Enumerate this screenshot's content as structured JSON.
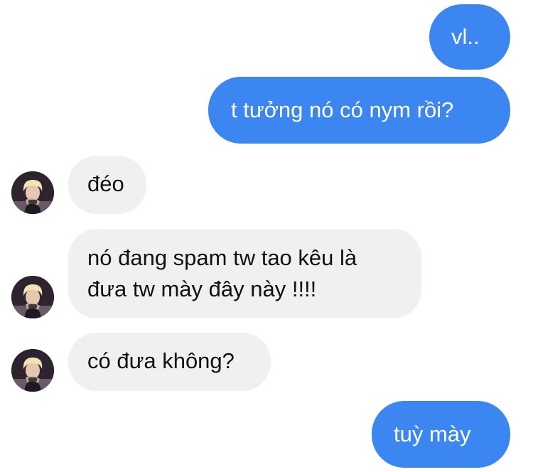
{
  "messages": [
    {
      "direction": "outgoing",
      "text": "vl.."
    },
    {
      "direction": "outgoing",
      "text": "t tưởng nó có nym rồi?"
    },
    {
      "direction": "incoming",
      "text": "đéo"
    },
    {
      "direction": "incoming",
      "lines": [
        "nó đang spam tw tao kêu là",
        "đưa tw mày đây này !!!!"
      ]
    },
    {
      "direction": "incoming",
      "text": "có đưa không?"
    },
    {
      "direction": "outgoing",
      "text": "tuỳ mày"
    }
  ],
  "colors": {
    "outgoing_bubble": "#3b86f0",
    "incoming_bubble": "#f0f0f0",
    "outgoing_text": "#ffffff",
    "incoming_text": "#111111"
  },
  "contact": {
    "avatar_icon": "blond-person-avatar-icon"
  }
}
